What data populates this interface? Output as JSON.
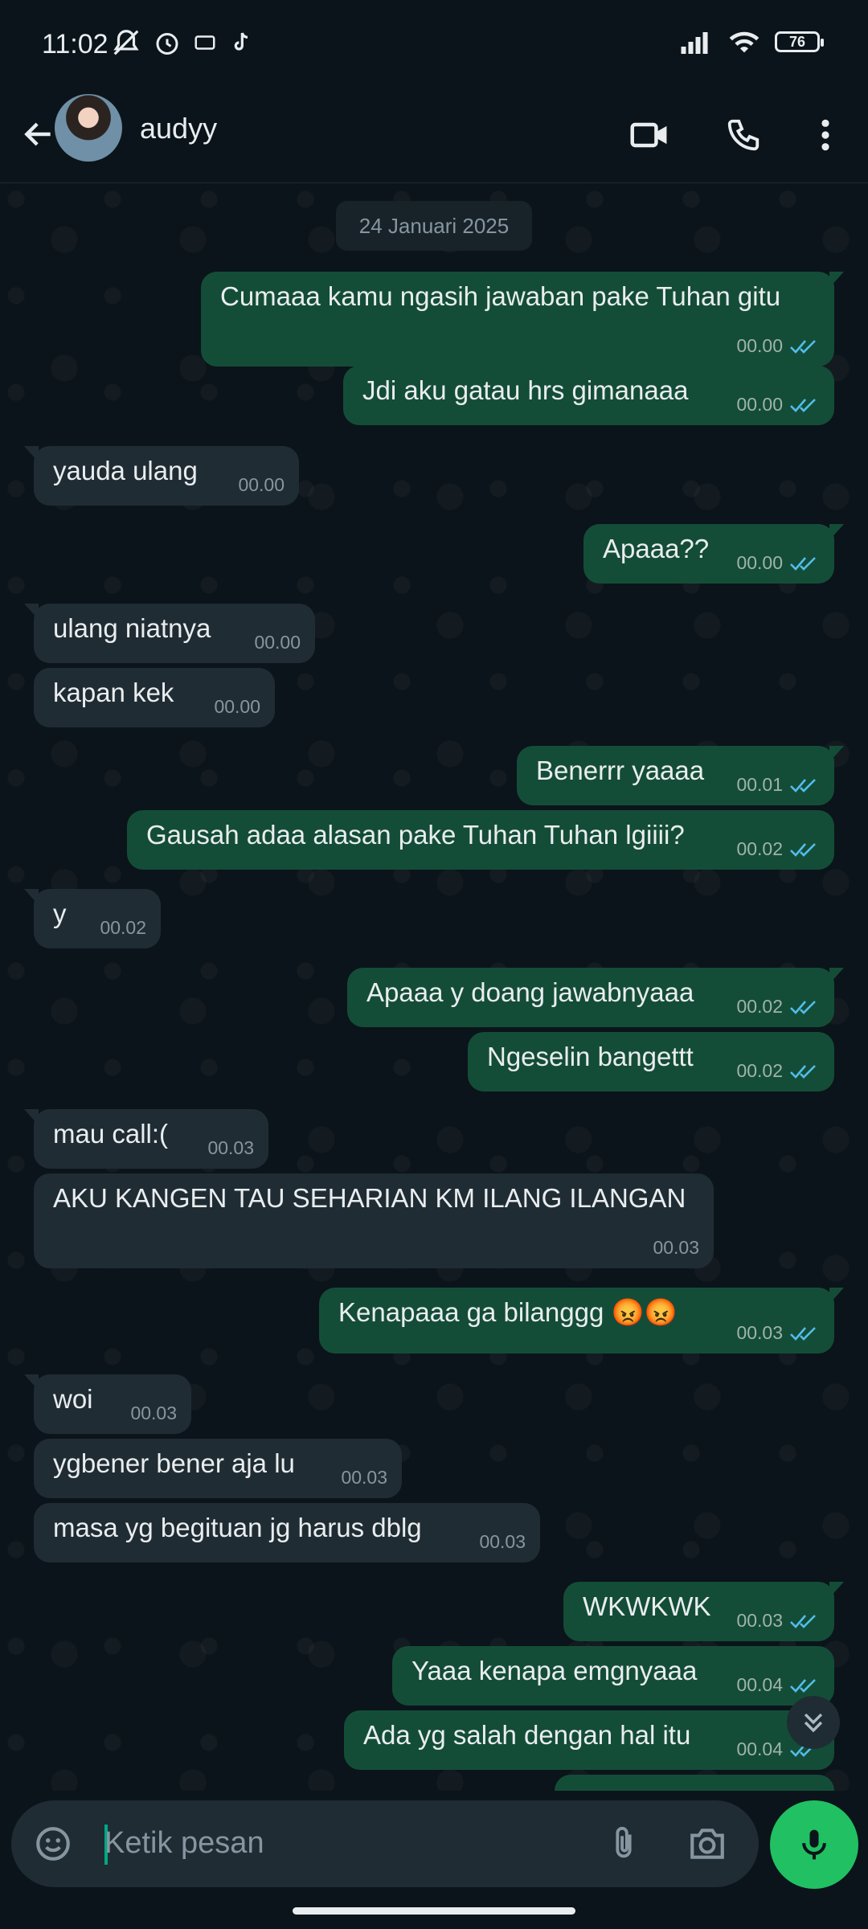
{
  "status_bar": {
    "time": "11:02",
    "battery": "76"
  },
  "header": {
    "contact_name": "audyy"
  },
  "chat": {
    "date": "24 Januari 2025",
    "messages": [
      {
        "dir": "out",
        "text": "Cumaaa kamu ngasih jawaban pake Tuhan gitu",
        "time": "00.00"
      },
      {
        "dir": "out",
        "text": "Jdi aku gatau hrs gimanaaa",
        "time": "00.00"
      },
      {
        "dir": "in",
        "text": "yauda ulang",
        "time": "00.00"
      },
      {
        "dir": "out",
        "text": "Apaaa??",
        "time": "00.00"
      },
      {
        "dir": "in",
        "text": "ulang niatnya",
        "time": "00.00"
      },
      {
        "dir": "in",
        "text": "kapan kek",
        "time": "00.00"
      },
      {
        "dir": "out",
        "text": "Benerrr yaaaa",
        "time": "00.01"
      },
      {
        "dir": "out",
        "text": "Gausah adaa alasan pake Tuhan Tuhan lgiiii?",
        "time": "00.02"
      },
      {
        "dir": "in",
        "text": "y",
        "time": "00.02"
      },
      {
        "dir": "out",
        "text": "Apaaa y doang jawabnyaaa",
        "time": "00.02"
      },
      {
        "dir": "out",
        "text": "Ngeselin bangettt",
        "time": "00.02"
      },
      {
        "dir": "in",
        "text": "mau call:(",
        "time": "00.03"
      },
      {
        "dir": "in",
        "text": "AKU KANGEN TAU SEHARIAN KM ILANG ILANGAN",
        "time": "00.03"
      },
      {
        "dir": "out",
        "text": "Kenapaaa ga bilanggg 😡😡",
        "time": "00.03"
      },
      {
        "dir": "in",
        "text": "woi",
        "time": "00.03"
      },
      {
        "dir": "in",
        "text": "ygbener bener aja lu",
        "time": "00.03"
      },
      {
        "dir": "in",
        "text": "masa yg begituan jg harus dblg",
        "time": "00.03"
      },
      {
        "dir": "out",
        "text": "WKWKWK",
        "time": "00.03"
      },
      {
        "dir": "out",
        "text": "Yaaa kenapa emgnyaaa",
        "time": "00.04"
      },
      {
        "dir": "out",
        "text": "Ada yg salah dengan hal itu",
        "time": "00.04"
      }
    ]
  },
  "composer": {
    "placeholder": "Ketik pesan"
  },
  "colors": {
    "out_bubble": "#144d37",
    "in_bubble": "#202c33",
    "accent": "#21c063",
    "read_tick": "#53bdeb"
  }
}
